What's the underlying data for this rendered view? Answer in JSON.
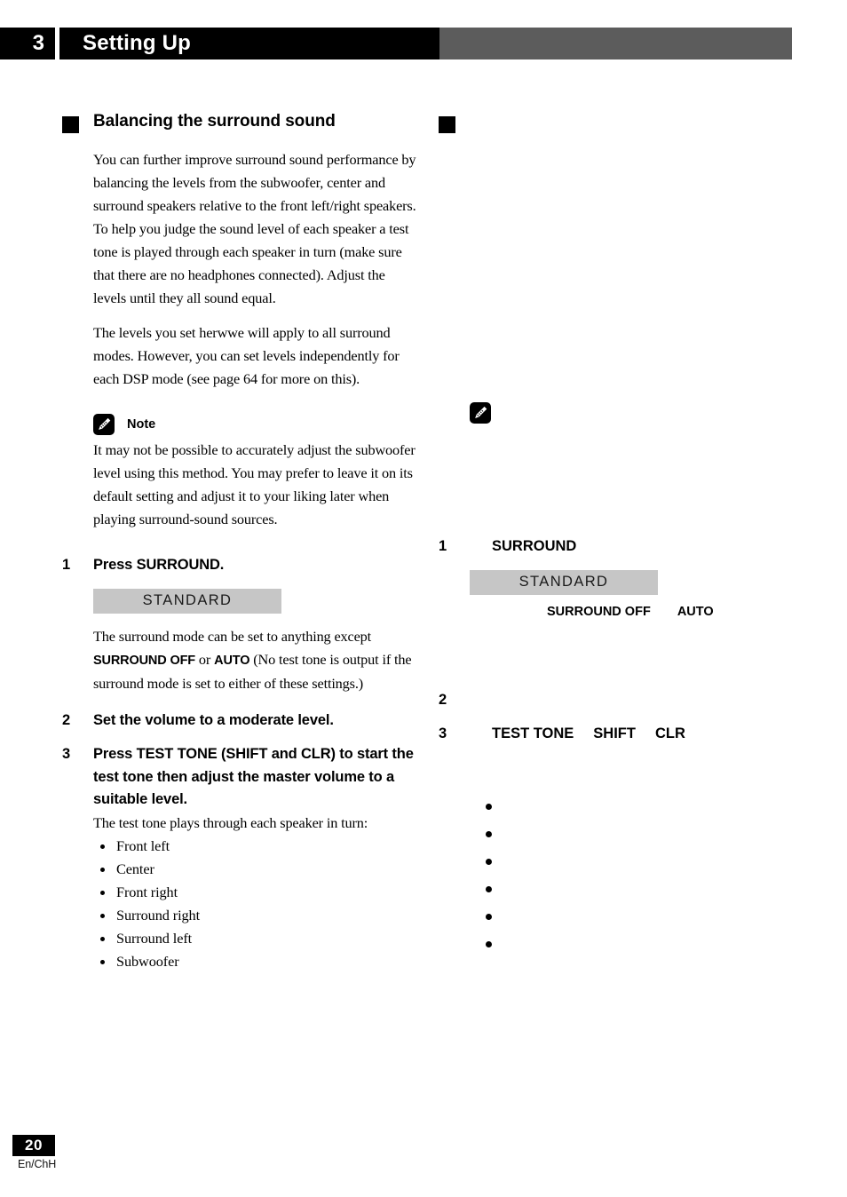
{
  "header": {
    "chapter_number": "3",
    "chapter_title": "Setting Up"
  },
  "left_column": {
    "section_heading": "Balancing the surround sound",
    "intro_paragraph_1": "You can further improve surround sound performance by balancing the levels from the subwoofer, center and surround speakers relative to the front left/right speakers. To help you judge the sound level of each speaker a test tone is played through each speaker in turn (make sure that there are no headphones connected). Adjust the levels until they all sound equal.",
    "intro_paragraph_2": "The levels you set herwwe will apply to all surround modes. However, you can set levels independently for each DSP mode (see page 64 for more on this).",
    "note_label": "Note",
    "note_body": "It may not be possible to accurately adjust the subwoofer level using this method. You may prefer to leave it on its default setting and adjust it to your liking later when playing surround-sound sources.",
    "steps": [
      {
        "number": "1",
        "title": "Press SURROUND.",
        "display_value": "STANDARD",
        "body_lead": "The surround mode can be set to anything except ",
        "body_bold_1": "SURROUND OFF",
        "body_mid": " or ",
        "body_bold_2": "AUTO",
        "body_tail": " (No test tone is output if the surround mode is set to either of these settings.)"
      },
      {
        "number": "2",
        "title": "Set the volume to a moderate level."
      },
      {
        "number": "3",
        "title": "Press TEST TONE (SHIFT and CLR) to start the test tone then adjust the master volume to a suitable level.",
        "body": "The test tone plays through each speaker in turn:"
      }
    ],
    "speaker_list": [
      "Front left",
      "Center",
      "Front right",
      "Surround right",
      "Surround left",
      "Subwoofer"
    ]
  },
  "right_column": {
    "section_heading": "",
    "note_label": "",
    "steps": [
      {
        "number": "1",
        "title": "SURROUND",
        "display_value": "STANDARD",
        "control_1": "SURROUND OFF",
        "control_2": "AUTO"
      },
      {
        "number": "2",
        "title": ""
      },
      {
        "number": "3",
        "control_1": "TEST TONE",
        "control_2": "SHIFT",
        "control_3": "CLR"
      }
    ],
    "speaker_list": [
      "",
      "",
      "",
      "",
      "",
      ""
    ]
  },
  "footer": {
    "page_number": "20",
    "language_code": "En/ChH"
  },
  "colors": {
    "header_black": "#000000",
    "header_gray": "#5c5c5c",
    "display_box_gray": "#c6c6c6",
    "text_black": "#000000",
    "page_white": "#ffffff"
  }
}
